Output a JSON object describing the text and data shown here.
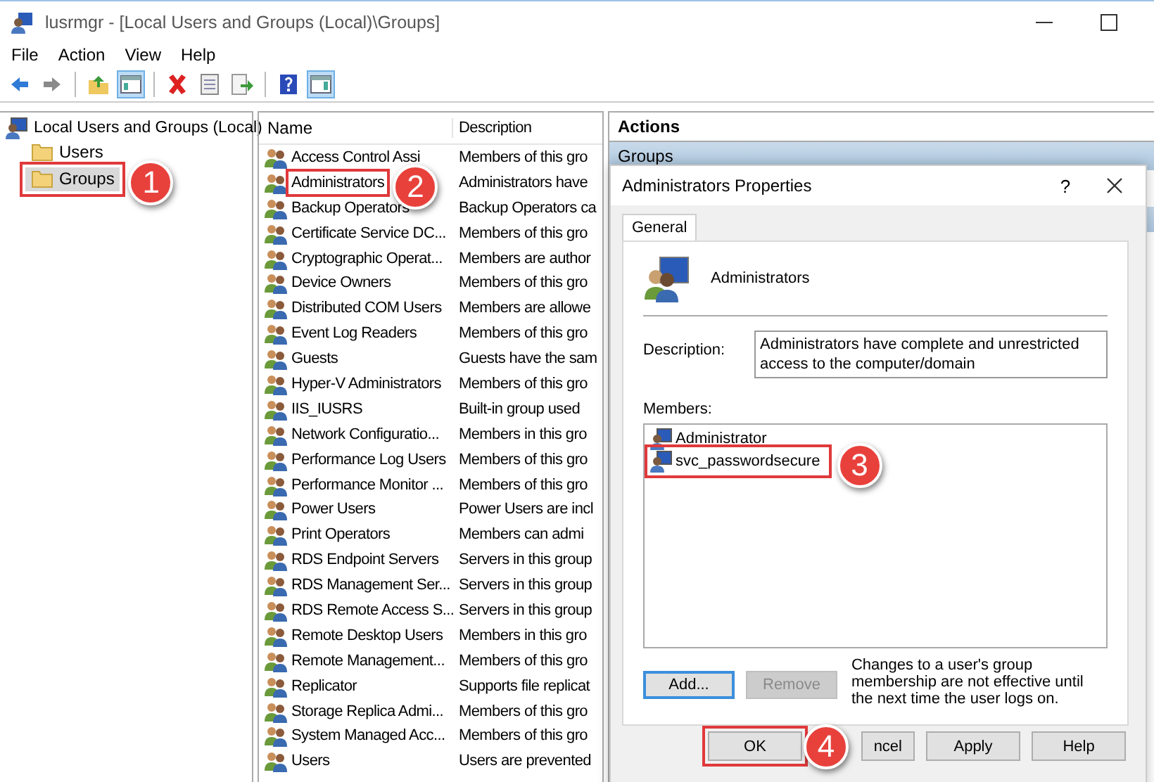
{
  "window": {
    "title": "lusrmgr - [Local Users and Groups (Local)\\Groups]"
  },
  "menu": [
    "File",
    "Action",
    "View",
    "Help"
  ],
  "toolbar": [
    {
      "kind": "back",
      "on": false
    },
    {
      "kind": "forward",
      "on": false
    },
    {
      "kind": "sep"
    },
    {
      "kind": "up",
      "on": false
    },
    {
      "kind": "tree",
      "on": true
    },
    {
      "kind": "sep"
    },
    {
      "kind": "delete",
      "on": false
    },
    {
      "kind": "properties",
      "on": false
    },
    {
      "kind": "export",
      "on": false
    },
    {
      "kind": "sep"
    },
    {
      "kind": "help",
      "on": false
    },
    {
      "kind": "pane",
      "on": true
    }
  ],
  "tree": {
    "label": "Local Users and Groups (Local)",
    "children": [
      {
        "label": "Users",
        "selected": false
      },
      {
        "label": "Groups",
        "selected": true,
        "callout": "1"
      }
    ]
  },
  "list": {
    "columns": [
      "Name",
      "Description"
    ],
    "rows": [
      {
        "name": "Access Control Assi",
        "description": "Members of this gro"
      },
      {
        "name": "Administrators",
        "description": "Administrators have",
        "callout": "2"
      },
      {
        "name": "Backup Operators",
        "description": "Backup Operators ca"
      },
      {
        "name": "Certificate Service DC...",
        "description": "Members of this gro"
      },
      {
        "name": "Cryptographic Operat...",
        "description": "Members are author"
      },
      {
        "name": "Device Owners",
        "description": "Members of this gro"
      },
      {
        "name": "Distributed COM Users",
        "description": "Members are allowe"
      },
      {
        "name": "Event Log Readers",
        "description": "Members of this gro"
      },
      {
        "name": "Guests",
        "description": "Guests have the sam"
      },
      {
        "name": "Hyper-V Administrators",
        "description": "Members of this gro"
      },
      {
        "name": "IIS_IUSRS",
        "description": "Built-in group used"
      },
      {
        "name": "Network Configuratio...",
        "description": "Members in this gro"
      },
      {
        "name": "Performance Log Users",
        "description": "Members of this gro"
      },
      {
        "name": "Performance Monitor ...",
        "description": "Members of this gro"
      },
      {
        "name": "Power Users",
        "description": "Power Users are incl"
      },
      {
        "name": "Print Operators",
        "description": "Members can admi"
      },
      {
        "name": "RDS Endpoint Servers",
        "description": "Servers in this group"
      },
      {
        "name": "RDS Management Ser...",
        "description": "Servers in this group"
      },
      {
        "name": "RDS Remote Access S...",
        "description": "Servers in this group"
      },
      {
        "name": "Remote Desktop Users",
        "description": "Members in this gro"
      },
      {
        "name": "Remote Management...",
        "description": "Members of this gro"
      },
      {
        "name": "Replicator",
        "description": "Supports file replicat"
      },
      {
        "name": "Storage Replica Admi...",
        "description": "Members of this gro"
      },
      {
        "name": "System Managed Acc...",
        "description": "Members of this gro"
      },
      {
        "name": "Users",
        "description": "Users are prevented"
      }
    ]
  },
  "actions": {
    "title": "Actions",
    "items": [
      "Groups"
    ]
  },
  "dialog": {
    "title": "Administrators Properties",
    "help": "?",
    "tabs": [
      {
        "label": "General",
        "selected": true
      }
    ],
    "group_name": "Administrators",
    "description_label": "Description:",
    "description": "Administrators have complete and unrestricted access to the computer/domain",
    "members_label": "Members:",
    "members": [
      {
        "name": "Administrator"
      },
      {
        "name": "svc_passwordsecure",
        "callout": "3"
      }
    ],
    "add": {
      "label": "Add...",
      "disabled": false
    },
    "remove": {
      "label": "Remove",
      "disabled": true
    },
    "note": "Changes to a user's group membership are not effective until the next time the user logs on.",
    "buttons": [
      {
        "label": "OK",
        "callout": "4"
      },
      {
        "label": "ncel"
      },
      {
        "label": "Apply"
      },
      {
        "label": "Help"
      }
    ]
  }
}
